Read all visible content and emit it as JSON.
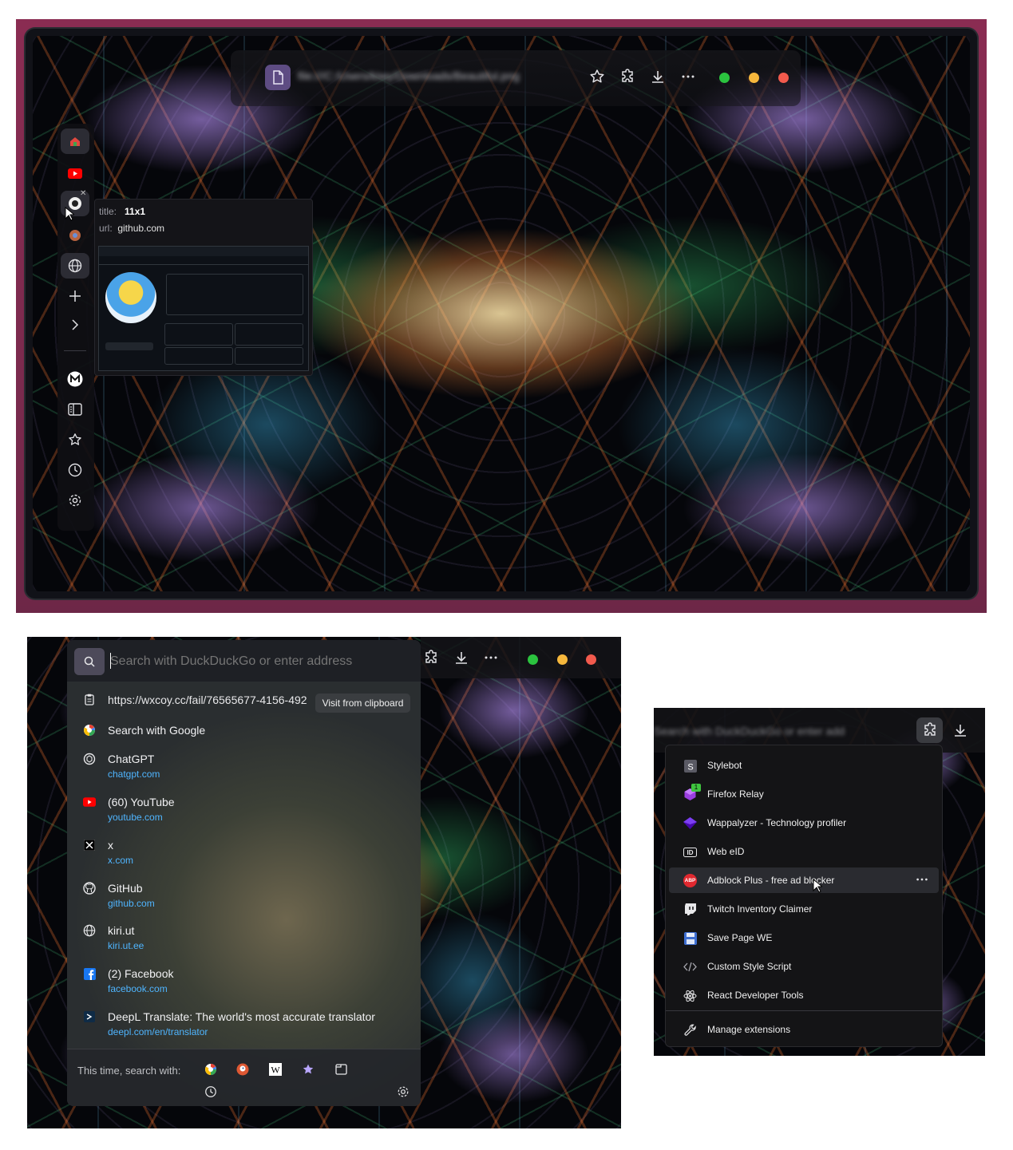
{
  "panel1": {
    "address_bar": {
      "url_text": "file:///C:/Users/kiwy/Downloads/Beautiful.png"
    },
    "toolbar": {
      "icons": [
        "bookmark-star-icon",
        "extensions-icon",
        "download-icon",
        "more-icon"
      ]
    },
    "window_dots": {
      "green": "#2bc33f",
      "yellow": "#f6b73c",
      "red": "#f25a4d"
    },
    "sidebar": {
      "items": [
        "home-icon",
        "youtube-icon",
        "github-icon",
        "chrome-icon",
        "globe-icon",
        "add-icon",
        "chevron-right-icon"
      ],
      "bottom": [
        "m-logo-icon",
        "sidebar-panel-icon",
        "star-icon",
        "history-icon",
        "gear-icon"
      ]
    },
    "tooltip": {
      "title_label": "title:",
      "title_value": "11x1",
      "url_label": "url:",
      "url_value": "github.com"
    }
  },
  "panel2": {
    "search_placeholder": "Search with DuckDuckGo or enter address",
    "clipboard": {
      "url": "https://wxcoy.cc/fail/76565677-4156-492",
      "button": "Visit from clipboard"
    },
    "search_google": "Search with Google",
    "suggestions": [
      {
        "title": "ChatGPT",
        "url": "chatgpt.com",
        "icon": "chatgpt-icon"
      },
      {
        "title": "(60) YouTube",
        "url": "youtube.com",
        "icon": "youtube-icon"
      },
      {
        "title": "x",
        "url": "x.com",
        "icon": "x-icon"
      },
      {
        "title": "GitHub",
        "url": "github.com",
        "icon": "github-icon"
      },
      {
        "title": "kiri.ut",
        "url": "kiri.ut.ee",
        "icon": "globe-icon"
      },
      {
        "title": "(2) Facebook",
        "url": "facebook.com",
        "icon": "facebook-icon"
      },
      {
        "title": "DeepL Translate: The world's most accurate translator",
        "url": "deepl.com/en/translator",
        "icon": "deepl-icon"
      }
    ],
    "footer": {
      "label": "This time, search with:",
      "engines": [
        "google-icon",
        "duckduckgo-icon",
        "wikipedia-icon",
        "bookmarks-star-icon",
        "tabs-icon",
        "history-icon"
      ]
    }
  },
  "panel3": {
    "address_placeholder": "Search with DuckDuckGo or enter address",
    "extensions": [
      {
        "label": "Stylebot",
        "icon": "stylebot-icon"
      },
      {
        "label": "Firefox Relay",
        "icon": "firefox-relay-icon",
        "badge": "1"
      },
      {
        "label": "Wappalyzer - Technology profiler",
        "icon": "wappalyzer-icon"
      },
      {
        "label": "Web eID",
        "icon": "web-eid-icon"
      },
      {
        "label": "Adblock Plus - free ad blocker",
        "icon": "adblock-plus-icon"
      },
      {
        "label": "Twitch Inventory Claimer",
        "icon": "twitch-icon"
      },
      {
        "label": "Save Page WE",
        "icon": "save-page-icon"
      },
      {
        "label": "Custom Style Script",
        "icon": "code-icon"
      },
      {
        "label": "React Developer Tools",
        "icon": "react-icon"
      }
    ],
    "manage": "Manage extensions",
    "abp_badge": "ABP"
  }
}
